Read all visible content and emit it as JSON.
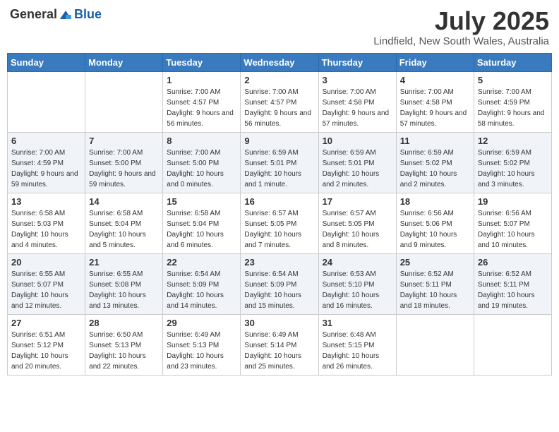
{
  "header": {
    "logo_general": "General",
    "logo_blue": "Blue",
    "month": "July 2025",
    "location": "Lindfield, New South Wales, Australia"
  },
  "weekdays": [
    "Sunday",
    "Monday",
    "Tuesday",
    "Wednesday",
    "Thursday",
    "Friday",
    "Saturday"
  ],
  "weeks": [
    [
      {
        "day": "",
        "info": ""
      },
      {
        "day": "",
        "info": ""
      },
      {
        "day": "1",
        "info": "Sunrise: 7:00 AM\nSunset: 4:57 PM\nDaylight: 9 hours and 56 minutes."
      },
      {
        "day": "2",
        "info": "Sunrise: 7:00 AM\nSunset: 4:57 PM\nDaylight: 9 hours and 56 minutes."
      },
      {
        "day": "3",
        "info": "Sunrise: 7:00 AM\nSunset: 4:58 PM\nDaylight: 9 hours and 57 minutes."
      },
      {
        "day": "4",
        "info": "Sunrise: 7:00 AM\nSunset: 4:58 PM\nDaylight: 9 hours and 57 minutes."
      },
      {
        "day": "5",
        "info": "Sunrise: 7:00 AM\nSunset: 4:59 PM\nDaylight: 9 hours and 58 minutes."
      }
    ],
    [
      {
        "day": "6",
        "info": "Sunrise: 7:00 AM\nSunset: 4:59 PM\nDaylight: 9 hours and 59 minutes."
      },
      {
        "day": "7",
        "info": "Sunrise: 7:00 AM\nSunset: 5:00 PM\nDaylight: 9 hours and 59 minutes."
      },
      {
        "day": "8",
        "info": "Sunrise: 7:00 AM\nSunset: 5:00 PM\nDaylight: 10 hours and 0 minutes."
      },
      {
        "day": "9",
        "info": "Sunrise: 6:59 AM\nSunset: 5:01 PM\nDaylight: 10 hours and 1 minute."
      },
      {
        "day": "10",
        "info": "Sunrise: 6:59 AM\nSunset: 5:01 PM\nDaylight: 10 hours and 2 minutes."
      },
      {
        "day": "11",
        "info": "Sunrise: 6:59 AM\nSunset: 5:02 PM\nDaylight: 10 hours and 2 minutes."
      },
      {
        "day": "12",
        "info": "Sunrise: 6:59 AM\nSunset: 5:02 PM\nDaylight: 10 hours and 3 minutes."
      }
    ],
    [
      {
        "day": "13",
        "info": "Sunrise: 6:58 AM\nSunset: 5:03 PM\nDaylight: 10 hours and 4 minutes."
      },
      {
        "day": "14",
        "info": "Sunrise: 6:58 AM\nSunset: 5:04 PM\nDaylight: 10 hours and 5 minutes."
      },
      {
        "day": "15",
        "info": "Sunrise: 6:58 AM\nSunset: 5:04 PM\nDaylight: 10 hours and 6 minutes."
      },
      {
        "day": "16",
        "info": "Sunrise: 6:57 AM\nSunset: 5:05 PM\nDaylight: 10 hours and 7 minutes."
      },
      {
        "day": "17",
        "info": "Sunrise: 6:57 AM\nSunset: 5:05 PM\nDaylight: 10 hours and 8 minutes."
      },
      {
        "day": "18",
        "info": "Sunrise: 6:56 AM\nSunset: 5:06 PM\nDaylight: 10 hours and 9 minutes."
      },
      {
        "day": "19",
        "info": "Sunrise: 6:56 AM\nSunset: 5:07 PM\nDaylight: 10 hours and 10 minutes."
      }
    ],
    [
      {
        "day": "20",
        "info": "Sunrise: 6:55 AM\nSunset: 5:07 PM\nDaylight: 10 hours and 12 minutes."
      },
      {
        "day": "21",
        "info": "Sunrise: 6:55 AM\nSunset: 5:08 PM\nDaylight: 10 hours and 13 minutes."
      },
      {
        "day": "22",
        "info": "Sunrise: 6:54 AM\nSunset: 5:09 PM\nDaylight: 10 hours and 14 minutes."
      },
      {
        "day": "23",
        "info": "Sunrise: 6:54 AM\nSunset: 5:09 PM\nDaylight: 10 hours and 15 minutes."
      },
      {
        "day": "24",
        "info": "Sunrise: 6:53 AM\nSunset: 5:10 PM\nDaylight: 10 hours and 16 minutes."
      },
      {
        "day": "25",
        "info": "Sunrise: 6:52 AM\nSunset: 5:11 PM\nDaylight: 10 hours and 18 minutes."
      },
      {
        "day": "26",
        "info": "Sunrise: 6:52 AM\nSunset: 5:11 PM\nDaylight: 10 hours and 19 minutes."
      }
    ],
    [
      {
        "day": "27",
        "info": "Sunrise: 6:51 AM\nSunset: 5:12 PM\nDaylight: 10 hours and 20 minutes."
      },
      {
        "day": "28",
        "info": "Sunrise: 6:50 AM\nSunset: 5:13 PM\nDaylight: 10 hours and 22 minutes."
      },
      {
        "day": "29",
        "info": "Sunrise: 6:49 AM\nSunset: 5:13 PM\nDaylight: 10 hours and 23 minutes."
      },
      {
        "day": "30",
        "info": "Sunrise: 6:49 AM\nSunset: 5:14 PM\nDaylight: 10 hours and 25 minutes."
      },
      {
        "day": "31",
        "info": "Sunrise: 6:48 AM\nSunset: 5:15 PM\nDaylight: 10 hours and 26 minutes."
      },
      {
        "day": "",
        "info": ""
      },
      {
        "day": "",
        "info": ""
      }
    ]
  ]
}
